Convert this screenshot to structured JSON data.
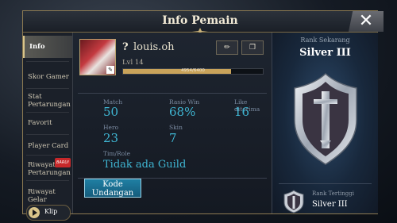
{
  "window": {
    "title": "Info Pemain",
    "close_icon": "close-icon"
  },
  "sidebar": {
    "items": [
      {
        "label": "Info",
        "active": true
      },
      {
        "label": "Skor Gamer"
      },
      {
        "label": "Stat Pertarungan",
        "line1": "Stat",
        "line2": "Pertarungan"
      },
      {
        "label": "Favorit"
      },
      {
        "label": "Player Card"
      },
      {
        "label": "Riwayat Pertarungan",
        "line1": "Riwayat",
        "line2": "Pertarungan",
        "badge": "BARU!"
      },
      {
        "label": "Riwayat Gelar"
      }
    ],
    "klip_label": "Klip"
  },
  "profile": {
    "question_mark": "?",
    "username": "louis.oh",
    "level": "Lvl 14",
    "exp_text": "4954/6400",
    "exp_fraction": 0.774
  },
  "stats": {
    "match": {
      "label": "Match",
      "value": "50"
    },
    "win_rate": {
      "label": "Rasio Win",
      "value": "68%"
    },
    "likes": {
      "label": "Like diterima",
      "value": "16"
    },
    "hero": {
      "label": "Hero",
      "value": "23"
    },
    "skin": {
      "label": "Skin",
      "value": "7"
    },
    "team": {
      "label": "Tim/Role",
      "value": "Tidak ada Guild"
    }
  },
  "invite_button": {
    "line1": "Kode",
    "line2": "Undangan"
  },
  "rank": {
    "current_label": "Rank Sekarang",
    "current_value": "Silver III",
    "highest_label": "Rank Tertinggi",
    "highest_value": "Silver III"
  },
  "colors": {
    "accent": "#3fb6d3",
    "gold": "#c9a35a",
    "badge": "#c7282a"
  }
}
